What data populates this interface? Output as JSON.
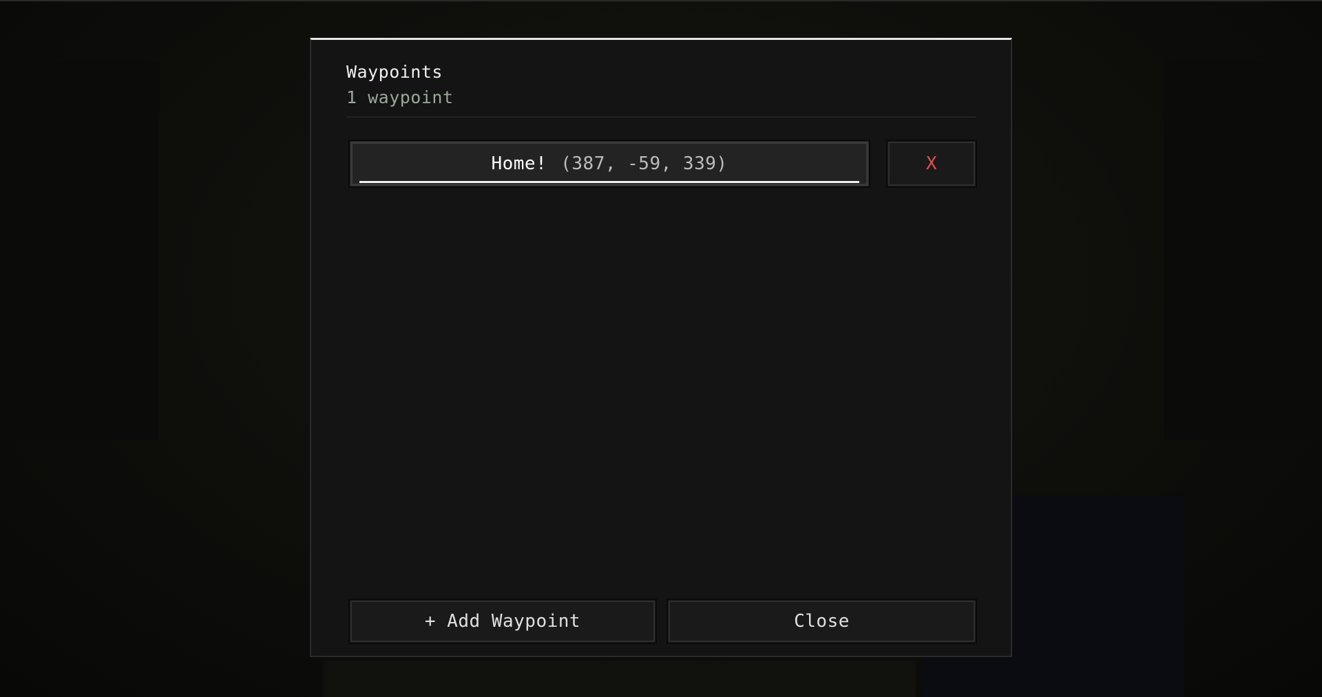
{
  "screen": {
    "title": "Waypoints",
    "subtitle": "1 waypoint"
  },
  "waypoints": [
    {
      "name": "Home!",
      "coords": "(387, -59, 339)",
      "delete_label": "X"
    }
  ],
  "footer": {
    "add_label": "+ Add Waypoint",
    "close_label": "Close"
  },
  "colors": {
    "panel_bg": "#141414",
    "accent_top": "#e8e8e8",
    "subtitle": "#9aa89a",
    "delete": "#e05050"
  }
}
